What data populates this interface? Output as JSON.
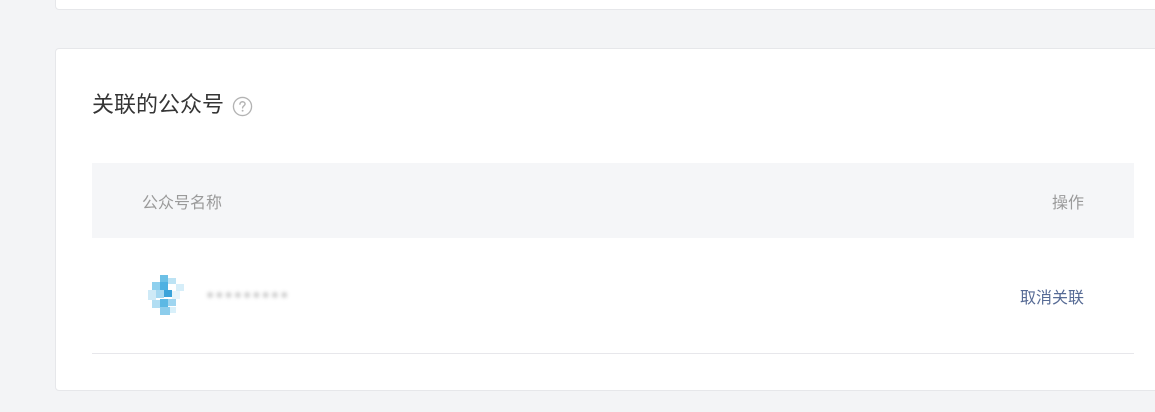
{
  "section": {
    "title": "关联的公众号"
  },
  "table": {
    "columns": [
      "公众号名称",
      "操作"
    ],
    "rows": [
      {
        "account_name": "•••••••••",
        "action": "取消关联"
      }
    ]
  },
  "icons": {
    "help": "question-circle-icon",
    "avatar": "pixelated-avatar-icon"
  },
  "colors": {
    "link": "#576b95",
    "header_bg": "#f5f6f8",
    "page_bg": "#f3f4f6"
  }
}
